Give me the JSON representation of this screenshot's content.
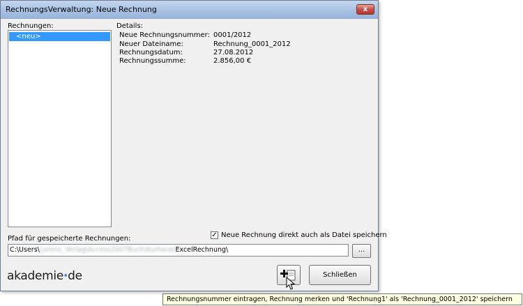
{
  "window": {
    "title": "RechnungsVerwaltung: Neue Rechnung",
    "close_glyph": "x"
  },
  "left_panel": {
    "label": "Rechnungen:",
    "items": [
      {
        "label": "<neu>",
        "selected": true
      }
    ]
  },
  "details": {
    "label": "Details:",
    "rows": [
      {
        "key": "Neue Rechnungsnummer:",
        "value": "0001/2012"
      },
      {
        "key": "Neuer Dateiname:",
        "value": "Rechnung_0001_2012"
      },
      {
        "key": "Rechnungsdatum:",
        "value": "27.08.2012"
      },
      {
        "key": "Rechnungssumme:",
        "value": "2.856,00 €"
      }
    ]
  },
  "save_option": {
    "label": "Neue Rechnung direkt auch als Datei speichern",
    "checked": true,
    "check_glyph": "✓"
  },
  "path": {
    "label": "Pfad für gespeicherte Rechnungen:",
    "prefix": "C:\\Users\\",
    "blurred_part": "Lorenz_Verlag\\Access2007Buch\\Kurhaus\\",
    "suffix": "ExcelRechnung\\",
    "browse_label": "..."
  },
  "logo": {
    "part1": "akademie",
    "dot": "·",
    "part2": "de"
  },
  "buttons": {
    "close_label": "Schließen"
  },
  "tooltip": {
    "text": "Rechnungsnummer eintragen, Rechnung merken und 'Rechnung1' als 'Rechnung_0001_2012' speichern"
  },
  "colors": {
    "selection": "#3399ff",
    "titlebar": "#a6c0e2",
    "close_button": "#c75050",
    "tooltip_bg": "#ffffe1"
  },
  "icons": [
    "close-icon",
    "new-invoice-icon",
    "mouse-cursor-icon"
  ]
}
